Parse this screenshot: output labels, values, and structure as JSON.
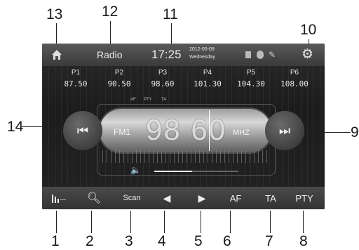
{
  "top_bar": {
    "title": "Radio",
    "time": "17:25",
    "date": "2012-05-09",
    "weekday": "Wednesday"
  },
  "presets": [
    {
      "label": "P1",
      "freq": "87.50"
    },
    {
      "label": "P2",
      "freq": "90.50"
    },
    {
      "label": "P3",
      "freq": "98.60"
    },
    {
      "label": "P4",
      "freq": "101.30"
    },
    {
      "label": "P5",
      "freq": "104.30"
    },
    {
      "label": "P6",
      "freq": "108.00"
    }
  ],
  "flags": {
    "af": "AF",
    "pty": "PTY",
    "ta": "TA"
  },
  "tuner": {
    "band": "FM1",
    "frequency": "98 60",
    "unit": "MHZ"
  },
  "bottom_bar": {
    "scan": "Scan",
    "af": "AF",
    "ta": "TA",
    "pty": "PTY"
  },
  "callouts": [
    "1",
    "2",
    "3",
    "4",
    "5",
    "6",
    "7",
    "8",
    "9",
    "10",
    "11",
    "12",
    "13",
    "14"
  ],
  "colors": {
    "screen_bg": "#1c1c1c",
    "bar_bg": "#3a3a3a",
    "text": "#e8e8e8"
  }
}
